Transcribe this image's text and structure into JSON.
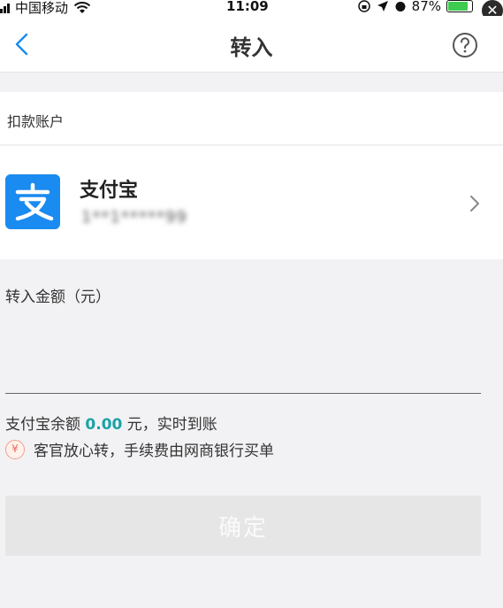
{
  "status_bar": {
    "carrier": "中国移动",
    "time": "11:09",
    "battery": "87%",
    "battery_level": 0.87,
    "close_glyph": "✕"
  },
  "nav": {
    "title": "转入",
    "back_icon": "chevron-left-icon",
    "help_icon": "question-circle-icon"
  },
  "deduction_account": {
    "label": "扣款账户",
    "name": "支付宝",
    "number": "1**1*****99",
    "logo_glyph": "支"
  },
  "amount": {
    "label": "转入金额（元）",
    "value": "",
    "placeholder": ""
  },
  "balance": {
    "prefix": "支付宝余额",
    "value": "0.00",
    "suffix": "元，实时到账"
  },
  "fee_notice": {
    "icon_glyph": "¥",
    "text": "客官放心转，手续费由网商银行买单"
  },
  "confirm_button": {
    "label": "确定"
  },
  "colors": {
    "accent_blue": "#1a8bf0",
    "balance_teal": "#1aa2a8",
    "button_disabled": "#e6e6e6",
    "battery_green": "#3ecb4f"
  }
}
